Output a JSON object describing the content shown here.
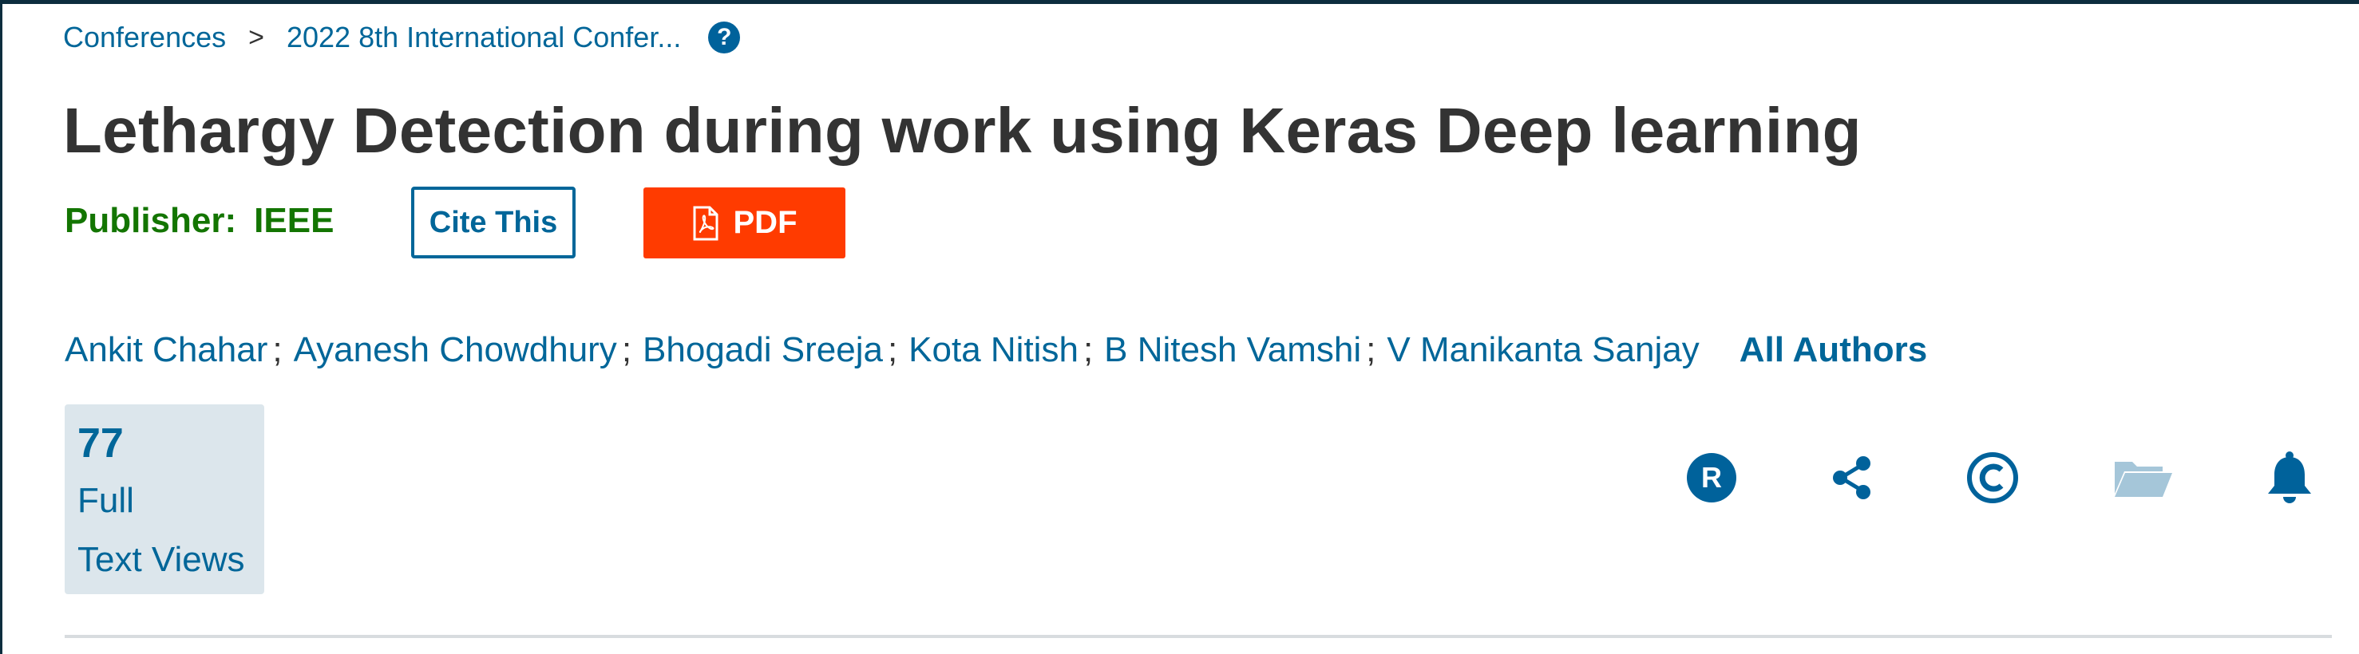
{
  "breadcrumb": {
    "items": [
      "Conferences",
      "2022 8th International Confer..."
    ],
    "separator": ">"
  },
  "article": {
    "title": "Lethargy Detection during work using Keras Deep learning",
    "publisher_label": "Publisher:",
    "publisher_name": "IEEE"
  },
  "buttons": {
    "cite": "Cite This",
    "pdf": "PDF"
  },
  "authors": {
    "list": [
      "Ankit Chahar",
      "Ayanesh Chowdhury",
      "Bhogadi Sreeja",
      "Kota Nitish",
      "B Nitesh Vamshi",
      "V Manikanta Sanjay"
    ],
    "separator": ";",
    "all_authors": "All Authors"
  },
  "metrics": {
    "count": "77",
    "label_line1": "Full",
    "label_line2": "Text Views"
  },
  "actions": [
    "rights-permissions-icon",
    "share-icon",
    "copyright-icon",
    "folder-icon",
    "alert-bell-icon"
  ],
  "colors": {
    "link": "#006699",
    "publisher": "#137501",
    "pdf_button": "#ff3b00",
    "metrics_bg": "#dce6ec",
    "folder_icon": "#a5c6d9"
  }
}
